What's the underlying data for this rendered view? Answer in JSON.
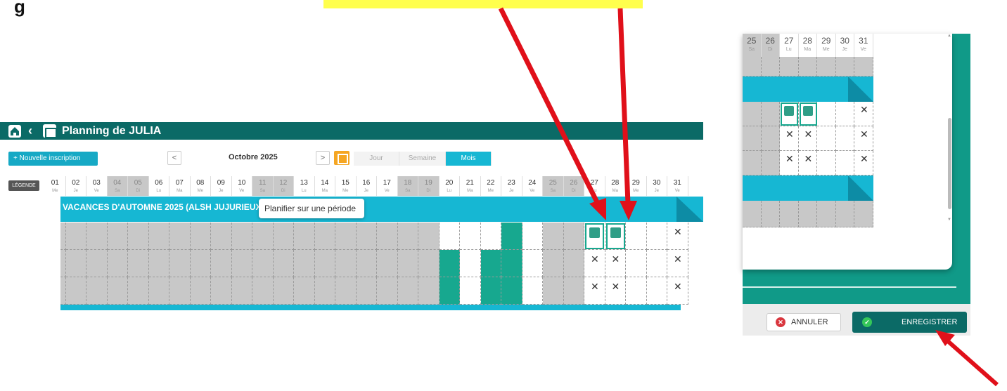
{
  "callouts": {
    "top_left_text": "g",
    "top_highlight_text": ""
  },
  "header": {
    "title": "Planning de JULIA",
    "home_icon": "home-icon",
    "back_icon": "chevron-left-icon",
    "calendar_icon": "calendar-check-icon"
  },
  "toolbar": {
    "new_registration": "+ Nouvelle inscription",
    "prev": "<",
    "month": "Octobre 2025",
    "next": ">",
    "tabs": [
      {
        "label": "Jour",
        "active": false
      },
      {
        "label": "Semaine",
        "active": false
      },
      {
        "label": "Mois",
        "active": true
      }
    ]
  },
  "legend_label": "LÉGENDE",
  "days": [
    {
      "num": "01",
      "wd": "Me",
      "we": false
    },
    {
      "num": "02",
      "wd": "Je",
      "we": false
    },
    {
      "num": "03",
      "wd": "Ve",
      "we": false
    },
    {
      "num": "04",
      "wd": "Sa",
      "we": true
    },
    {
      "num": "05",
      "wd": "Di",
      "we": true
    },
    {
      "num": "06",
      "wd": "Lu",
      "we": false
    },
    {
      "num": "07",
      "wd": "Ma",
      "we": false
    },
    {
      "num": "08",
      "wd": "Me",
      "we": false
    },
    {
      "num": "09",
      "wd": "Je",
      "we": false
    },
    {
      "num": "10",
      "wd": "Ve",
      "we": false
    },
    {
      "num": "11",
      "wd": "Sa",
      "we": true
    },
    {
      "num": "12",
      "wd": "Di",
      "we": true
    },
    {
      "num": "13",
      "wd": "Lu",
      "we": false
    },
    {
      "num": "14",
      "wd": "Ma",
      "we": false
    },
    {
      "num": "15",
      "wd": "Me",
      "we": false
    },
    {
      "num": "16",
      "wd": "Je",
      "we": false
    },
    {
      "num": "17",
      "wd": "Ve",
      "we": false
    },
    {
      "num": "18",
      "wd": "Sa",
      "we": true
    },
    {
      "num": "19",
      "wd": "Di",
      "we": true
    },
    {
      "num": "20",
      "wd": "Lu",
      "we": false
    },
    {
      "num": "21",
      "wd": "Ma",
      "we": false
    },
    {
      "num": "22",
      "wd": "Me",
      "we": false
    },
    {
      "num": "23",
      "wd": "Je",
      "we": false
    },
    {
      "num": "24",
      "wd": "Ve",
      "we": false
    },
    {
      "num": "25",
      "wd": "Sa",
      "we": true
    },
    {
      "num": "26",
      "wd": "Di",
      "we": true
    },
    {
      "num": "27",
      "wd": "Lu",
      "we": false
    },
    {
      "num": "28",
      "wd": "Ma",
      "we": false
    },
    {
      "num": "29",
      "wd": "Me",
      "we": false
    },
    {
      "num": "30",
      "wd": "Je",
      "we": false
    },
    {
      "num": "31",
      "wd": "Ve",
      "we": false
    }
  ],
  "banner": {
    "title": "VACANCES D'AUTOMNE 2025 (ALSH JUJURIEUX)",
    "tooltip": "Planifier sur une période"
  },
  "grid": {
    "rows": [
      [
        "g",
        "g",
        "g",
        "g",
        "g",
        "g",
        "g",
        "g",
        "g",
        "g",
        "g",
        "g",
        "g",
        "g",
        "g",
        "g",
        "g",
        "g",
        "g",
        "w",
        "w",
        "w",
        "t",
        "w",
        "g",
        "g",
        "B",
        "B",
        "w",
        "w",
        "N"
      ],
      [
        "g",
        "g",
        "g",
        "g",
        "g",
        "g",
        "g",
        "g",
        "g",
        "g",
        "g",
        "g",
        "g",
        "g",
        "g",
        "g",
        "g",
        "g",
        "g",
        "t",
        "w",
        "t",
        "t",
        "w",
        "g",
        "g",
        "N",
        "N",
        "w",
        "w",
        "N"
      ],
      [
        "g",
        "g",
        "g",
        "g",
        "g",
        "g",
        "g",
        "g",
        "g",
        "g",
        "g",
        "g",
        "g",
        "g",
        "g",
        "g",
        "g",
        "g",
        "g",
        "t",
        "w",
        "t",
        "t",
        "w",
        "g",
        "g",
        "N",
        "N",
        "w",
        "w",
        "N"
      ]
    ]
  },
  "panel": {
    "days": [
      {
        "num": "25",
        "wd": "Sa",
        "we": true
      },
      {
        "num": "26",
        "wd": "Di",
        "we": true
      },
      {
        "num": "27",
        "wd": "Lu",
        "we": false
      },
      {
        "num": "28",
        "wd": "Ma",
        "we": false
      },
      {
        "num": "29",
        "wd": "Me",
        "we": false
      },
      {
        "num": "30",
        "wd": "Je",
        "we": false
      },
      {
        "num": "31",
        "wd": "Ve",
        "we": false
      }
    ],
    "rows": [
      [
        "g",
        "g",
        "B",
        "B",
        "w",
        "w",
        "N"
      ],
      [
        "g",
        "g",
        "N",
        "N",
        "w",
        "w",
        "N"
      ],
      [
        "g",
        "g",
        "N",
        "N",
        "w",
        "w",
        "N"
      ]
    ],
    "cancel_label": "ANNULER",
    "save_label": "ENREGISTRER"
  },
  "colors": {
    "header": "#0b6a66",
    "banner": "#16b7d3",
    "teal_cell": "#17a88f",
    "weekend": "#c8c8c8",
    "arrow": "#e0101a",
    "highlight": "#ffff4d"
  },
  "icons": {
    "not_registered": "no-person-icon",
    "registered": "person-check-icon"
  }
}
